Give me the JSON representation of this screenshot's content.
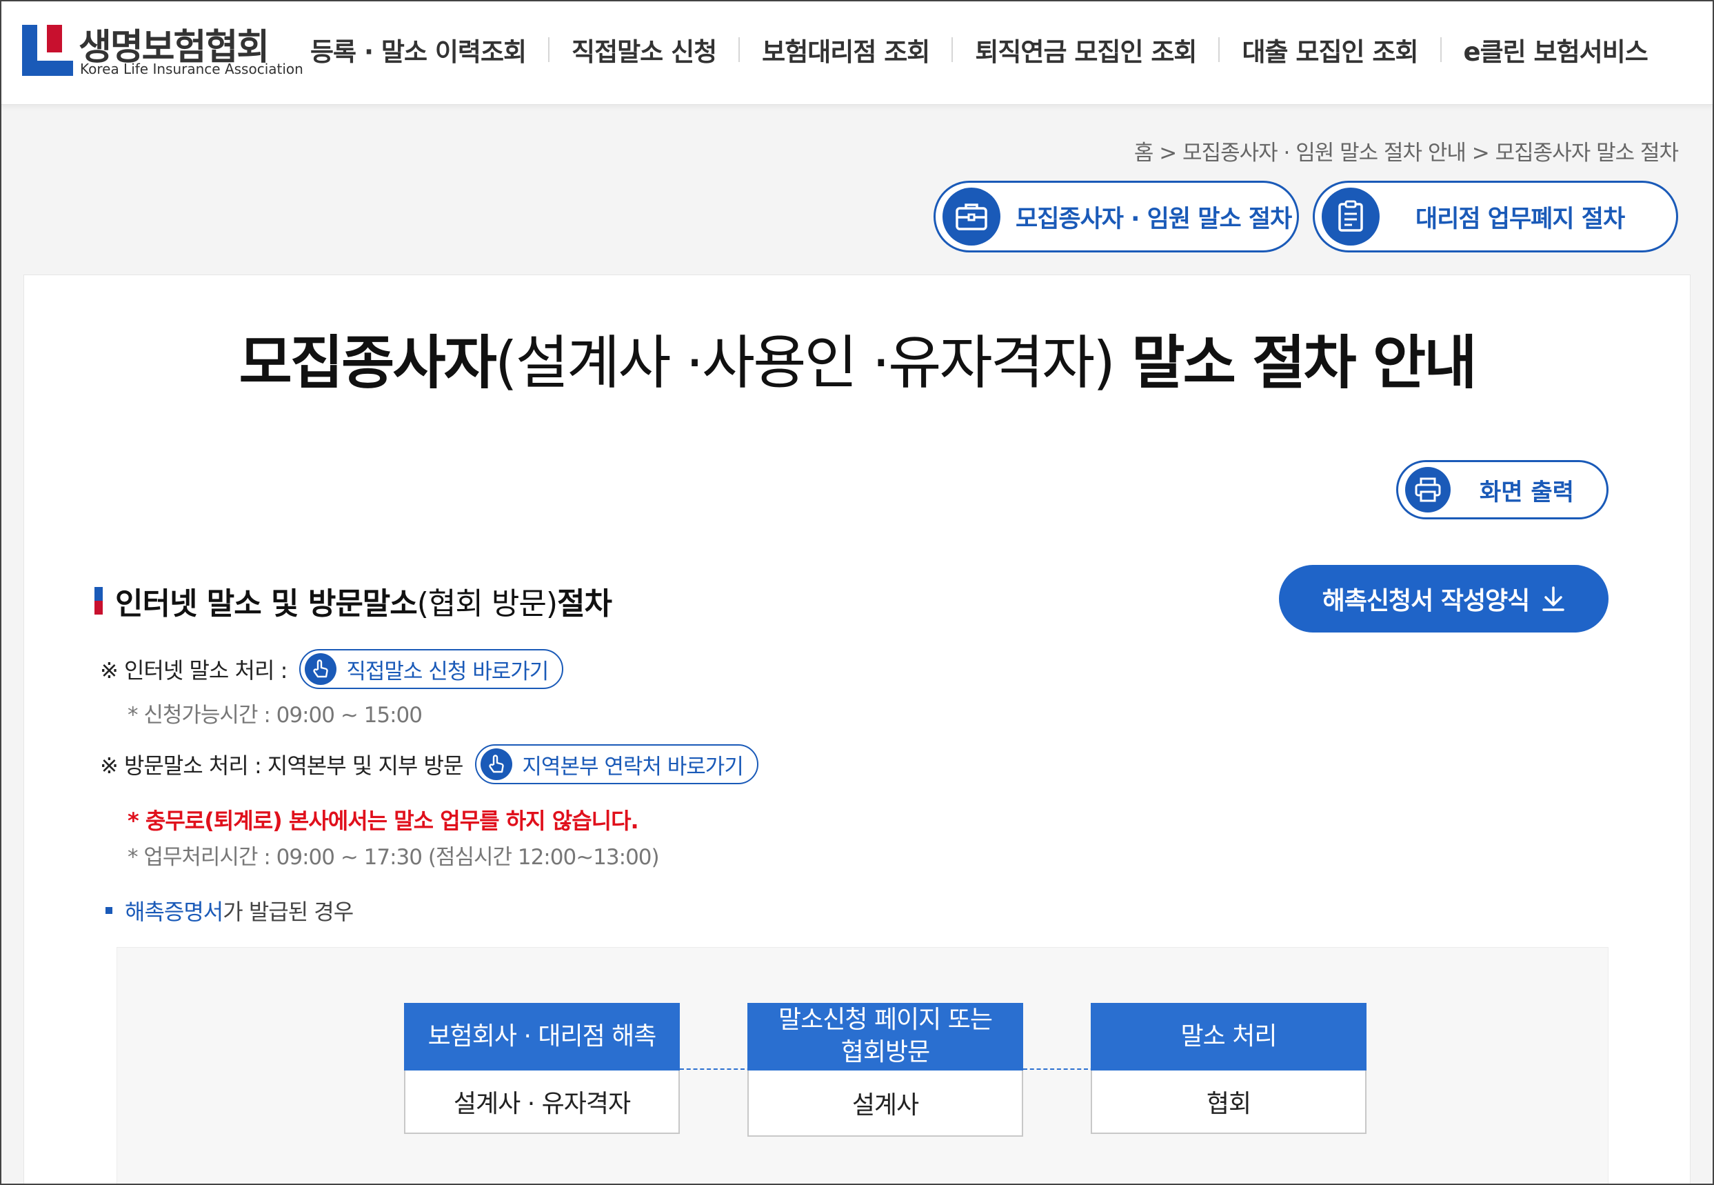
{
  "header": {
    "logo_ko": "생명보험협회",
    "logo_en": "Korea Life Insurance Association",
    "nav": [
      {
        "label": "등록 · 말소 이력조회"
      },
      {
        "label": "직접말소 신청"
      },
      {
        "label": "보험대리점 조회"
      },
      {
        "label": "퇴직연금 모집인 조회"
      },
      {
        "label": "대출 모집인 조회"
      },
      {
        "label": "e클린 보험서비스"
      }
    ]
  },
  "breadcrumb": "홈 > 모집종사자 · 임원 말소 절차 안내 > 모집종사자 말소 절차",
  "quick_buttons": [
    {
      "label": "모집종사자 · 임원 말소 절차",
      "icon": "briefcase-icon"
    },
    {
      "label": "대리점 업무폐지 절차",
      "icon": "clipboard-icon"
    }
  ],
  "title": {
    "bold1": "모집종사자",
    "light": "(설계사 ·사용인 ·유자격자)",
    "bold2": " 말소 절차 안내"
  },
  "print_label": "화면 출력",
  "download_label": "해촉신청서 작성양식",
  "section": {
    "bold1": "인터넷 말소 및 방문말소",
    "light": "(협회 방문)",
    "bold2": " 절차"
  },
  "internet": {
    "label": "※ 인터넷 말소 처리 :",
    "link": "직접말소 신청 바로가기",
    "hours": "* 신청가능시간 : 09:00 ~ 15:00"
  },
  "visit": {
    "label": "※ 방문말소 처리 : 지역본부 및 지부 방문",
    "link": "지역본부 연락처 바로가기",
    "warning": "* 충무로(퇴계로) 본사에서는 말소 업무를 하지 않습니다.",
    "hours": "* 업무처리시간 : 09:00 ~ 17:30 (점심시간 12:00~13:00)"
  },
  "bullet": {
    "highlight": "해촉증명서",
    "rest": "가 발급된 경우"
  },
  "flow": [
    {
      "head": "보험회사 · 대리점 해촉",
      "body": "설계사 · 유자격자"
    },
    {
      "head": "말소신청 페이지 또는\n협회방문",
      "body": "설계사"
    },
    {
      "head": "말소 처리",
      "body": "협회"
    }
  ],
  "colors": {
    "brand_blue": "#1a5ab8",
    "brand_red": "#c8102e",
    "warning_red": "#e0101c"
  }
}
